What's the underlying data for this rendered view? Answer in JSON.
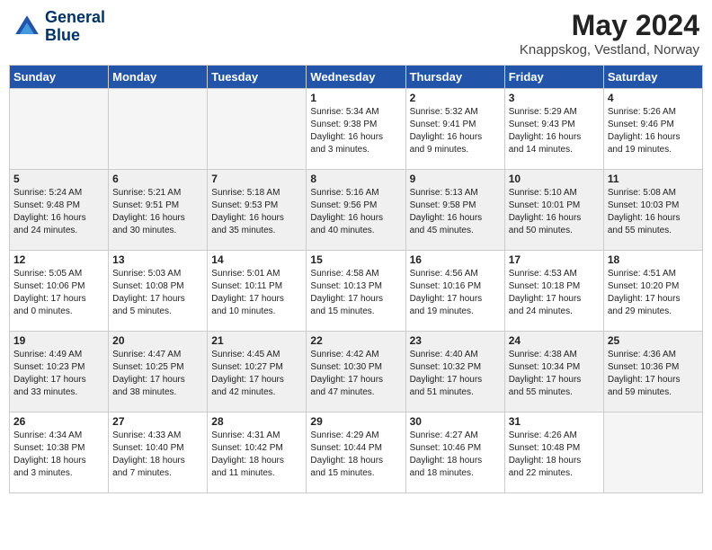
{
  "header": {
    "logo_line1": "General",
    "logo_line2": "Blue",
    "month_year": "May 2024",
    "location": "Knappskog, Vestland, Norway"
  },
  "weekdays": [
    "Sunday",
    "Monday",
    "Tuesday",
    "Wednesday",
    "Thursday",
    "Friday",
    "Saturday"
  ],
  "weeks": [
    [
      {
        "day": "",
        "info": ""
      },
      {
        "day": "",
        "info": ""
      },
      {
        "day": "",
        "info": ""
      },
      {
        "day": "1",
        "info": "Sunrise: 5:34 AM\nSunset: 9:38 PM\nDaylight: 16 hours\nand 3 minutes."
      },
      {
        "day": "2",
        "info": "Sunrise: 5:32 AM\nSunset: 9:41 PM\nDaylight: 16 hours\nand 9 minutes."
      },
      {
        "day": "3",
        "info": "Sunrise: 5:29 AM\nSunset: 9:43 PM\nDaylight: 16 hours\nand 14 minutes."
      },
      {
        "day": "4",
        "info": "Sunrise: 5:26 AM\nSunset: 9:46 PM\nDaylight: 16 hours\nand 19 minutes."
      }
    ],
    [
      {
        "day": "5",
        "info": "Sunrise: 5:24 AM\nSunset: 9:48 PM\nDaylight: 16 hours\nand 24 minutes."
      },
      {
        "day": "6",
        "info": "Sunrise: 5:21 AM\nSunset: 9:51 PM\nDaylight: 16 hours\nand 30 minutes."
      },
      {
        "day": "7",
        "info": "Sunrise: 5:18 AM\nSunset: 9:53 PM\nDaylight: 16 hours\nand 35 minutes."
      },
      {
        "day": "8",
        "info": "Sunrise: 5:16 AM\nSunset: 9:56 PM\nDaylight: 16 hours\nand 40 minutes."
      },
      {
        "day": "9",
        "info": "Sunrise: 5:13 AM\nSunset: 9:58 PM\nDaylight: 16 hours\nand 45 minutes."
      },
      {
        "day": "10",
        "info": "Sunrise: 5:10 AM\nSunset: 10:01 PM\nDaylight: 16 hours\nand 50 minutes."
      },
      {
        "day": "11",
        "info": "Sunrise: 5:08 AM\nSunset: 10:03 PM\nDaylight: 16 hours\nand 55 minutes."
      }
    ],
    [
      {
        "day": "12",
        "info": "Sunrise: 5:05 AM\nSunset: 10:06 PM\nDaylight: 17 hours\nand 0 minutes."
      },
      {
        "day": "13",
        "info": "Sunrise: 5:03 AM\nSunset: 10:08 PM\nDaylight: 17 hours\nand 5 minutes."
      },
      {
        "day": "14",
        "info": "Sunrise: 5:01 AM\nSunset: 10:11 PM\nDaylight: 17 hours\nand 10 minutes."
      },
      {
        "day": "15",
        "info": "Sunrise: 4:58 AM\nSunset: 10:13 PM\nDaylight: 17 hours\nand 15 minutes."
      },
      {
        "day": "16",
        "info": "Sunrise: 4:56 AM\nSunset: 10:16 PM\nDaylight: 17 hours\nand 19 minutes."
      },
      {
        "day": "17",
        "info": "Sunrise: 4:53 AM\nSunset: 10:18 PM\nDaylight: 17 hours\nand 24 minutes."
      },
      {
        "day": "18",
        "info": "Sunrise: 4:51 AM\nSunset: 10:20 PM\nDaylight: 17 hours\nand 29 minutes."
      }
    ],
    [
      {
        "day": "19",
        "info": "Sunrise: 4:49 AM\nSunset: 10:23 PM\nDaylight: 17 hours\nand 33 minutes."
      },
      {
        "day": "20",
        "info": "Sunrise: 4:47 AM\nSunset: 10:25 PM\nDaylight: 17 hours\nand 38 minutes."
      },
      {
        "day": "21",
        "info": "Sunrise: 4:45 AM\nSunset: 10:27 PM\nDaylight: 17 hours\nand 42 minutes."
      },
      {
        "day": "22",
        "info": "Sunrise: 4:42 AM\nSunset: 10:30 PM\nDaylight: 17 hours\nand 47 minutes."
      },
      {
        "day": "23",
        "info": "Sunrise: 4:40 AM\nSunset: 10:32 PM\nDaylight: 17 hours\nand 51 minutes."
      },
      {
        "day": "24",
        "info": "Sunrise: 4:38 AM\nSunset: 10:34 PM\nDaylight: 17 hours\nand 55 minutes."
      },
      {
        "day": "25",
        "info": "Sunrise: 4:36 AM\nSunset: 10:36 PM\nDaylight: 17 hours\nand 59 minutes."
      }
    ],
    [
      {
        "day": "26",
        "info": "Sunrise: 4:34 AM\nSunset: 10:38 PM\nDaylight: 18 hours\nand 3 minutes."
      },
      {
        "day": "27",
        "info": "Sunrise: 4:33 AM\nSunset: 10:40 PM\nDaylight: 18 hours\nand 7 minutes."
      },
      {
        "day": "28",
        "info": "Sunrise: 4:31 AM\nSunset: 10:42 PM\nDaylight: 18 hours\nand 11 minutes."
      },
      {
        "day": "29",
        "info": "Sunrise: 4:29 AM\nSunset: 10:44 PM\nDaylight: 18 hours\nand 15 minutes."
      },
      {
        "day": "30",
        "info": "Sunrise: 4:27 AM\nSunset: 10:46 PM\nDaylight: 18 hours\nand 18 minutes."
      },
      {
        "day": "31",
        "info": "Sunrise: 4:26 AM\nSunset: 10:48 PM\nDaylight: 18 hours\nand 22 minutes."
      },
      {
        "day": "",
        "info": ""
      }
    ]
  ]
}
